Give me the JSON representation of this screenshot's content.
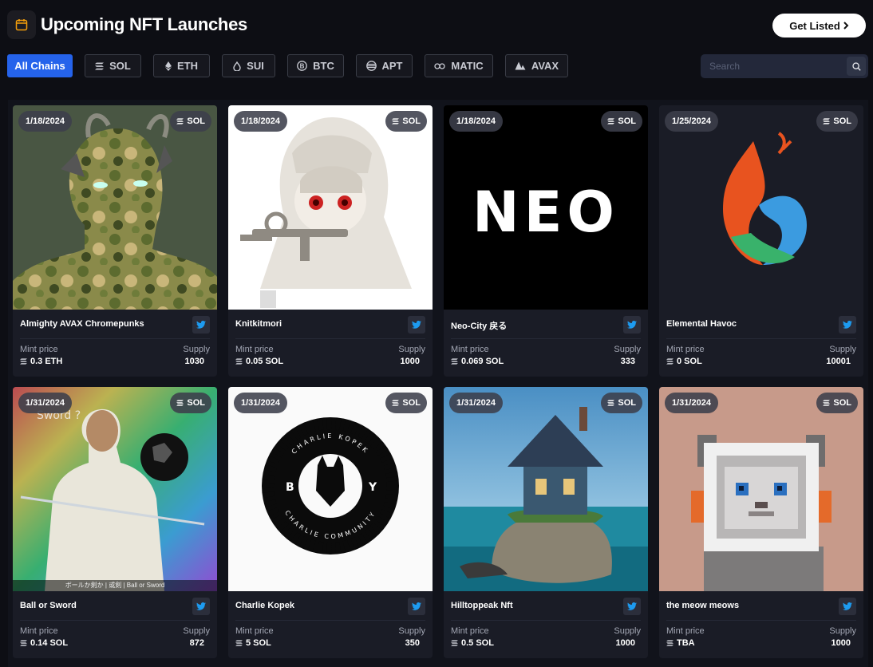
{
  "header": {
    "title": "Upcoming NFT Launches",
    "calendar_icon": "calendar-icon",
    "get_listed_label": "Get Listed",
    "get_listed_icon": "chevron-right-icon"
  },
  "filters": [
    {
      "label": "All Chains",
      "active": true
    },
    {
      "label": "SOL",
      "icon": "solana-icon"
    },
    {
      "label": "ETH",
      "icon": "ethereum-icon"
    },
    {
      "label": "SUI",
      "icon": "sui-icon"
    },
    {
      "label": "BTC",
      "icon": "bitcoin-icon"
    },
    {
      "label": "APT",
      "icon": "aptos-icon"
    },
    {
      "label": "MATIC",
      "icon": "polygon-icon"
    },
    {
      "label": "AVAX",
      "icon": "avalanche-icon"
    }
  ],
  "search": {
    "placeholder": "Search",
    "icon": "search-icon"
  },
  "colors": {
    "accent": "#2563eb",
    "background": "#0d0e14",
    "card": "#1a1c26",
    "twitter": "#1d9bf0"
  },
  "cards": [
    {
      "date": "1/18/2024",
      "chain": "SOL",
      "name": "Almighty AVAX Chromepunks",
      "mint_label": "Mint price",
      "mint_price": "0.3 ETH",
      "supply_label": "Supply",
      "supply": "1030"
    },
    {
      "date": "1/18/2024",
      "chain": "SOL",
      "name": "Knitkitmori",
      "mint_label": "Mint price",
      "mint_price": "0.05 SOL",
      "supply_label": "Supply",
      "supply": "1000"
    },
    {
      "date": "1/18/2024",
      "chain": "SOL",
      "name": "Neo-City 戻る",
      "mint_label": "Mint price",
      "mint_price": "0.069 SOL",
      "supply_label": "Supply",
      "supply": "333",
      "artwork_text": "NEO"
    },
    {
      "date": "1/25/2024",
      "chain": "SOL",
      "name": "Elemental Havoc",
      "mint_label": "Mint price",
      "mint_price": "0 SOL",
      "supply_label": "Supply",
      "supply": "10001"
    },
    {
      "date": "1/31/2024",
      "chain": "SOL",
      "name": "Ball or Sword",
      "mint_label": "Mint price",
      "mint_price": "0.14 SOL",
      "supply_label": "Supply",
      "supply": "872",
      "artwork_text": "Sword ?",
      "artwork_caption": "ボールか剣か | 或剣 | Ball or Sword"
    },
    {
      "date": "1/31/2024",
      "chain": "SOL",
      "name": "Charlie Kopek",
      "mint_label": "Mint price",
      "mint_price": "5 SOL",
      "supply_label": "Supply",
      "supply": "350",
      "artwork_ring_top": "CHARLIE KOPEK",
      "artwork_ring_bottom": "CHARLIE COMMUNITY",
      "artwork_left": "B",
      "artwork_right": "Y"
    },
    {
      "date": "1/31/2024",
      "chain": "SOL",
      "name": "Hilltoppeak Nft",
      "mint_label": "Mint price",
      "mint_price": "0.5 SOL",
      "supply_label": "Supply",
      "supply": "1000"
    },
    {
      "date": "1/31/2024",
      "chain": "SOL",
      "name": "the meow meows",
      "mint_label": "Mint price",
      "mint_price": "TBA",
      "supply_label": "Supply",
      "supply": "1000"
    }
  ]
}
